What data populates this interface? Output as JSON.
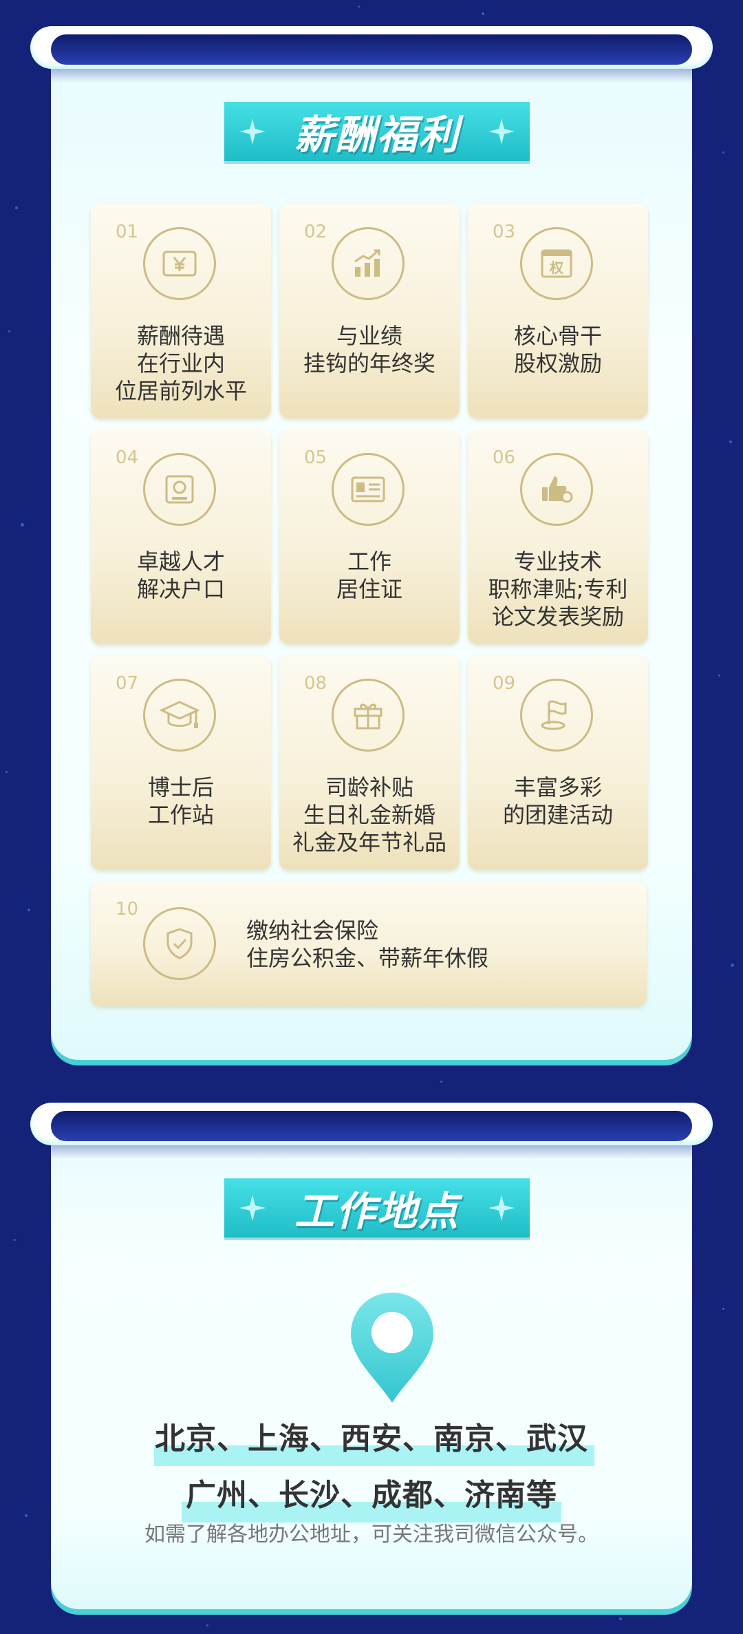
{
  "welfare": {
    "title": "薪酬福利",
    "items": [
      {
        "num": "01",
        "icon": "yen-ticket-icon",
        "lines": [
          "薪酬待遇",
          "在行业内",
          "位居前列水平"
        ]
      },
      {
        "num": "02",
        "icon": "growth-chart-icon",
        "lines": [
          "与业绩",
          "挂钩的年终奖"
        ]
      },
      {
        "num": "03",
        "icon": "equity-certificate-icon",
        "lines": [
          "核心骨干",
          "股权激励"
        ]
      },
      {
        "num": "04",
        "icon": "talent-badge-icon",
        "lines": [
          "卓越人才",
          "解决户口"
        ]
      },
      {
        "num": "05",
        "icon": "residence-card-icon",
        "lines": [
          "工作",
          "居住证"
        ]
      },
      {
        "num": "06",
        "icon": "thumbs-up-award-icon",
        "lines": [
          "专业技术",
          "职称津贴;专利",
          "论文发表奖励"
        ]
      },
      {
        "num": "07",
        "icon": "graduation-cap-icon",
        "lines": [
          "博士后",
          "工作站"
        ]
      },
      {
        "num": "08",
        "icon": "gift-icon",
        "lines": [
          "司龄补贴",
          "生日礼金新婚",
          "礼金及年节礼品"
        ]
      },
      {
        "num": "09",
        "icon": "flag-icon",
        "lines": [
          "丰富多彩",
          "的团建活动"
        ]
      },
      {
        "num": "10",
        "icon": "shield-check-icon",
        "lines": [
          "缴纳社会保险",
          "住房公积金、带薪年休假"
        ]
      }
    ]
  },
  "location": {
    "title": "工作地点",
    "icon": "map-pin-icon",
    "cities_line1": "北京、上海、西安、南京、武汉",
    "cities_line2": "广州、长沙、成都、济南等",
    "note": "如需了解各地办公地址，可关注我司微信公众号。"
  },
  "colors": {
    "background": "#14227a",
    "accent_teal": "#2fd0d8",
    "card_gold": "#cdbb84"
  }
}
